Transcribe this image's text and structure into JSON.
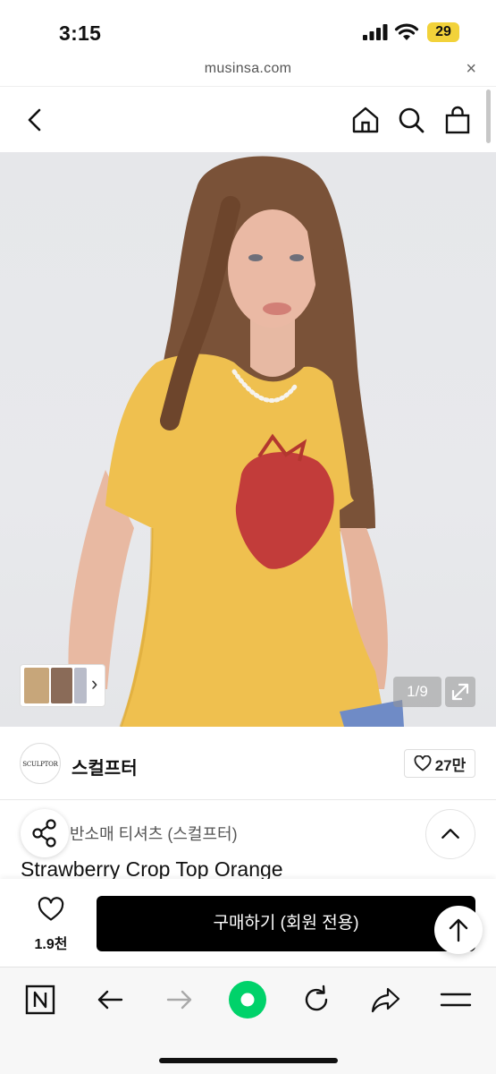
{
  "status_bar": {
    "time": "3:15",
    "battery": "29"
  },
  "url_bar": {
    "domain": "musinsa.com",
    "close": "×"
  },
  "product_image": {
    "counter": "1/9",
    "thumbnail_arrow": "›"
  },
  "brand": {
    "logo_text": "SCULPTOR",
    "name": "스컬프터",
    "likes": "27만"
  },
  "product": {
    "category": "반소매 티셔츠 (스컬프터)",
    "title": "Strawberry Crop Top Orange"
  },
  "purchase": {
    "wish_count": "1.9천",
    "buy_label": "구매하기 (회원 전용)"
  },
  "colors": {
    "buy_button": "#000000",
    "accent_green": "#00d26a",
    "battery": "#f2d23a"
  },
  "icons": [
    "back-icon",
    "home-icon",
    "search-icon",
    "bag-icon",
    "share-icon",
    "chevron-up-icon",
    "heart-icon",
    "arrow-up-icon",
    "naver-n-icon",
    "arrow-left-icon",
    "arrow-right-icon",
    "green-dot-icon",
    "refresh-icon",
    "forward-share-icon",
    "menu-icon"
  ]
}
